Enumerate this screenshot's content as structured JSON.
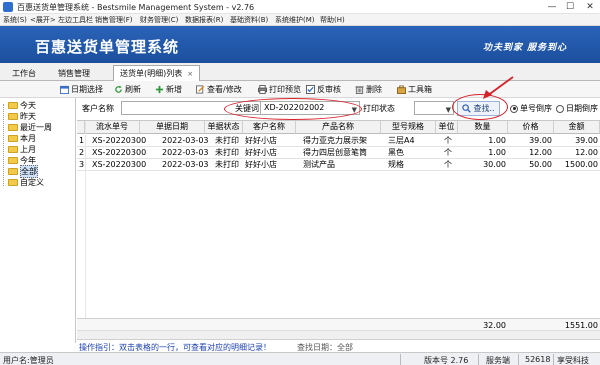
{
  "window": {
    "title": "百惠送货单管理系统 - Bestsmile Management System - v2.76"
  },
  "menu": [
    "系统(S)",
    "<展开> 左边工具栏",
    "销售管理(F)",
    "财务管理(C)",
    "数据报表(R)",
    "基础资料(B)",
    "系统维护(M)",
    "帮助(H)"
  ],
  "banner": {
    "title": "百惠送货单管理系统",
    "slogan": "功夫到家  服务到心"
  },
  "tabs": [
    {
      "label": "工作台"
    },
    {
      "label": "销售管理"
    },
    {
      "label": "送货单(明细)列表",
      "close": "×"
    }
  ],
  "toolbar": {
    "date_select": "日期选择",
    "refresh": "刷新",
    "add": "新增",
    "view_edit": "查看/修改",
    "print_preview": "打印预览",
    "unaudit": "反审核",
    "delete": "删除",
    "toolbox": "工具箱"
  },
  "tree": [
    "今天",
    "昨天",
    "最近一周",
    "本月",
    "上月",
    "今年",
    "全部",
    "自定义"
  ],
  "search": {
    "customer_label": "客户名称",
    "customer_value": "",
    "keyword_label": "关键词",
    "keyword_value": "XD-202202002",
    "print_status_label": "打印状态",
    "print_status_value": "",
    "find_button": "查找..",
    "sort_order_desc": "单号倒序",
    "sort_date_desc": "日期倒序"
  },
  "grid": {
    "columns": [
      "流水单号",
      "单据日期",
      "单据状态",
      "客户名称",
      "产品名称",
      "型号规格",
      "单位",
      "数量",
      "价格",
      "金额"
    ],
    "rows": [
      {
        "no": "1",
        "cells": [
          "XS-202203001",
          "2022-03-03",
          "未打印",
          "好好小店",
          "得力亚克力展示架",
          "三层A4",
          "个",
          "1.00",
          "39.00",
          "39.00"
        ]
      },
      {
        "no": "2",
        "cells": [
          "XS-202203001",
          "2022-03-03",
          "未打印",
          "好好小店",
          "得力四层创意笔筒",
          "黑色",
          "个",
          "1.00",
          "12.00",
          "12.00"
        ]
      },
      {
        "no": "3",
        "cells": [
          "XS-202203001",
          "2022-03-03",
          "未打印",
          "好好小店",
          "测试产品",
          "规格",
          "个",
          "30.00",
          "50.00",
          "1500.00"
        ]
      }
    ],
    "total_qty": "32.00",
    "total_amount": "1551.00"
  },
  "hint": {
    "text": "操作指引：双击表格的一行，可查看对应的明细记录！",
    "search_date": "查找日期：全部"
  },
  "status": {
    "user": "用户名:管理员",
    "version": "版本号 2.76",
    "server_label": "服务端",
    "port": "52618",
    "company": "享受科技"
  },
  "colors": {
    "banner": "#2a63b8",
    "annotation_red": "#d8202a",
    "hint_blue": "#1c3fb0"
  }
}
